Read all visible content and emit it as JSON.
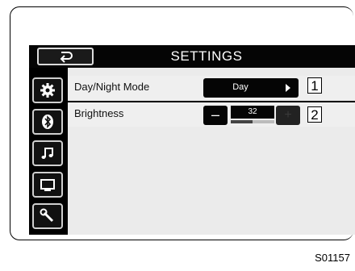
{
  "header": {
    "title": "SETTINGS",
    "back_icon": "return-arrow-icon"
  },
  "sidebar": {
    "items": [
      {
        "name": "general-settings",
        "icon": "gear-icon"
      },
      {
        "name": "bluetooth",
        "icon": "bluetooth-icon"
      },
      {
        "name": "audio",
        "icon": "music-note-icon"
      },
      {
        "name": "display",
        "icon": "monitor-icon"
      },
      {
        "name": "tools",
        "icon": "wrench-icon"
      }
    ]
  },
  "settings": {
    "day_night": {
      "label": "Day/Night Mode",
      "value": "Day",
      "callout": "1"
    },
    "brightness": {
      "label": "Brightness",
      "value": "32",
      "minus": "–",
      "plus": "+",
      "level_fraction": 0.5,
      "callout": "2"
    }
  },
  "figure_id": "S01157",
  "colors": {
    "header_bg": "#050505",
    "screen_bg": "#ebebeb",
    "button_bg": "#050505"
  }
}
